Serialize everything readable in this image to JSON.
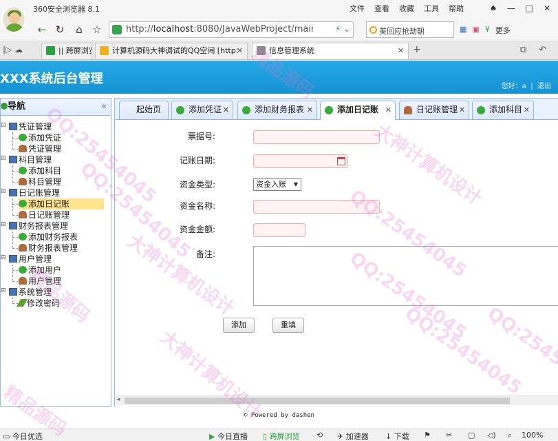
{
  "browser": {
    "title": "360安全浏览器 8.1",
    "menus": [
      "文件",
      "查看",
      "收藏",
      "工具",
      "帮助"
    ],
    "url_host": "localhost",
    "url_rest": ":8080/JavaWebProject/main.j",
    "url_prefix": "http://",
    "search_text": "美回应抢劫朝",
    "more_label": "更多",
    "tabs": [
      {
        "label": "|| 跨屏浏览",
        "fav_color": "#2aa040"
      },
      {
        "label": "计算机源码大神调试的QQ空间 [http:",
        "fav_color": "#f0b020"
      },
      {
        "label": "信息管理系统",
        "fav_color": "#888888"
      }
    ]
  },
  "app": {
    "title": "XXX系统后台管理",
    "user_greeting": "您好：a",
    "logout": "退出",
    "footer": "© Powered by dashen"
  },
  "sidebar": {
    "title": "导航",
    "collapse": "«",
    "nodes": [
      {
        "label": "凭证管理",
        "icon": "folder-icon"
      },
      {
        "label": "添加凭证",
        "icon": "add-icon"
      },
      {
        "label": "凭证管理",
        "icon": "user-icon"
      },
      {
        "label": "科目管理",
        "icon": "folder-icon"
      },
      {
        "label": "添加科目",
        "icon": "add-icon"
      },
      {
        "label": "科目管理",
        "icon": "user-icon"
      },
      {
        "label": "日记账管理",
        "icon": "folder-icon"
      },
      {
        "label": "添加日记账",
        "icon": "add-icon"
      },
      {
        "label": "日记账管理",
        "icon": "user-icon"
      },
      {
        "label": "财务报表管理",
        "icon": "folder-icon"
      },
      {
        "label": "添加财务报表",
        "icon": "add-icon"
      },
      {
        "label": "财务报表管理",
        "icon": "user-icon"
      },
      {
        "label": "用户管理",
        "icon": "folder-icon"
      },
      {
        "label": "添加用户",
        "icon": "add-icon"
      },
      {
        "label": "用户管理",
        "icon": "user-icon"
      },
      {
        "label": "系统管理",
        "icon": "folder-icon"
      },
      {
        "label": "修改密码",
        "icon": "pen-icon"
      }
    ]
  },
  "tabs": [
    {
      "label": "起始页",
      "closable": false
    },
    {
      "label": "添加凭证",
      "closable": true
    },
    {
      "label": "添加财务报表",
      "closable": true
    },
    {
      "label": "添加日记账",
      "closable": true
    },
    {
      "label": "日记账管理",
      "closable": true
    },
    {
      "label": "添加科目",
      "closable": true
    }
  ],
  "form": {
    "fields": {
      "receipt_no": "票据号:",
      "date": "记账日期:",
      "fund_type": "资金类型:",
      "fund_name": "资金名称:",
      "amount": "资金金额:",
      "note": "备注:"
    },
    "fund_type_selected": "资金入账",
    "submit": "添加",
    "reset": "重填"
  },
  "statusbar": {
    "left": "今日优选",
    "live": "今日直播",
    "cross": "跨屏浏览",
    "accel": "加速器",
    "download": "下载",
    "zoom": "100%"
  },
  "watermarks": [
    "精品源码",
    "大神计算机设计",
    "QQ:25454045",
    "QQ:25454045",
    "大神计算机设计",
    "QQ:25454045",
    "精品源码",
    "QQ:25454045",
    "大神计算机设计",
    "精品源码",
    "QQ:25454045",
    "QQ:25454045"
  ]
}
